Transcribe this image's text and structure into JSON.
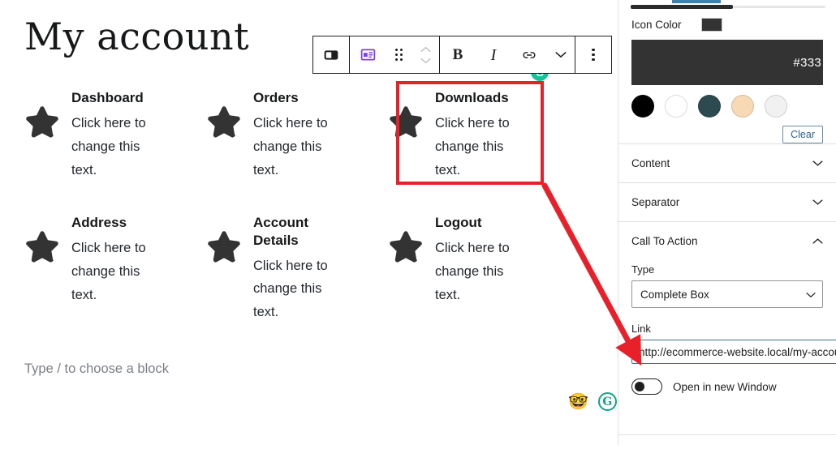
{
  "editor": {
    "page_title": "My account",
    "block_placeholder": "Type / to choose a block",
    "cards": [
      {
        "title": "Dashboard",
        "text": "Click here to change this text.",
        "icon": "star-icon",
        "selected": false
      },
      {
        "title": "Orders",
        "text": "Click here to change this text.",
        "icon": "star-icon",
        "selected": false
      },
      {
        "title": "Downloads",
        "text": "Click here to change this text.",
        "icon": "star-icon",
        "selected": true
      },
      {
        "title": "Address",
        "text": "Click here to change this text.",
        "icon": "star-icon",
        "selected": false
      },
      {
        "title": "Account Details",
        "text": "Click here to change this text.",
        "icon": "star-icon",
        "selected": false
      },
      {
        "title": "Logout",
        "text": "Click here to change this text.",
        "icon": "star-icon",
        "selected": false
      }
    ],
    "status_icons": [
      {
        "name": "nerd-face-emoji",
        "glyph": "🤓"
      },
      {
        "name": "grammarly-logo",
        "glyph": "G"
      }
    ],
    "grammarly_canvas_badge": "G"
  },
  "toolbar": {
    "buttons": [
      {
        "name": "columns-layout-icon",
        "label": ""
      },
      {
        "name": "block-type-icon",
        "label": ""
      },
      {
        "name": "drag-handle-icon",
        "label": ""
      },
      {
        "name": "move-up-down-icon",
        "label": ""
      },
      {
        "name": "bold-button",
        "label": "B"
      },
      {
        "name": "italic-button",
        "label": "I"
      },
      {
        "name": "link-button",
        "label": ""
      },
      {
        "name": "more-formatting-icon",
        "label": ""
      },
      {
        "name": "block-options-icon",
        "label": ""
      }
    ]
  },
  "sidebar": {
    "icon_color": {
      "label": "Icon Color",
      "hex": "#333",
      "swatch_color": "#333333",
      "palette": [
        {
          "name": "black-swatch",
          "color": "#000000"
        },
        {
          "name": "white-swatch",
          "color": "#ffffff"
        },
        {
          "name": "dark-teal-swatch",
          "color": "#2d4a50"
        },
        {
          "name": "peach-swatch",
          "color": "#f7d9b5"
        },
        {
          "name": "light-gray-swatch",
          "color": "#f1f1f1"
        }
      ],
      "clear_label": "Clear"
    },
    "panels": [
      {
        "name": "content-panel",
        "title": "Content",
        "expanded": false
      },
      {
        "name": "separator-panel",
        "title": "Separator",
        "expanded": false
      },
      {
        "name": "cta-panel",
        "title": "Call To Action",
        "expanded": true
      }
    ],
    "cta": {
      "type_label": "Type",
      "type_value": "Complete Box",
      "type_options": [
        "Complete Box"
      ],
      "link_label": "Link",
      "link_value": "http://ecommerce-website.local/my-account/downloads/",
      "toggle_label": "Open in new Window",
      "toggle_on": false
    }
  },
  "annotations": {
    "highlight_color": "#e8202a",
    "arrow_color": "#e8202a"
  }
}
